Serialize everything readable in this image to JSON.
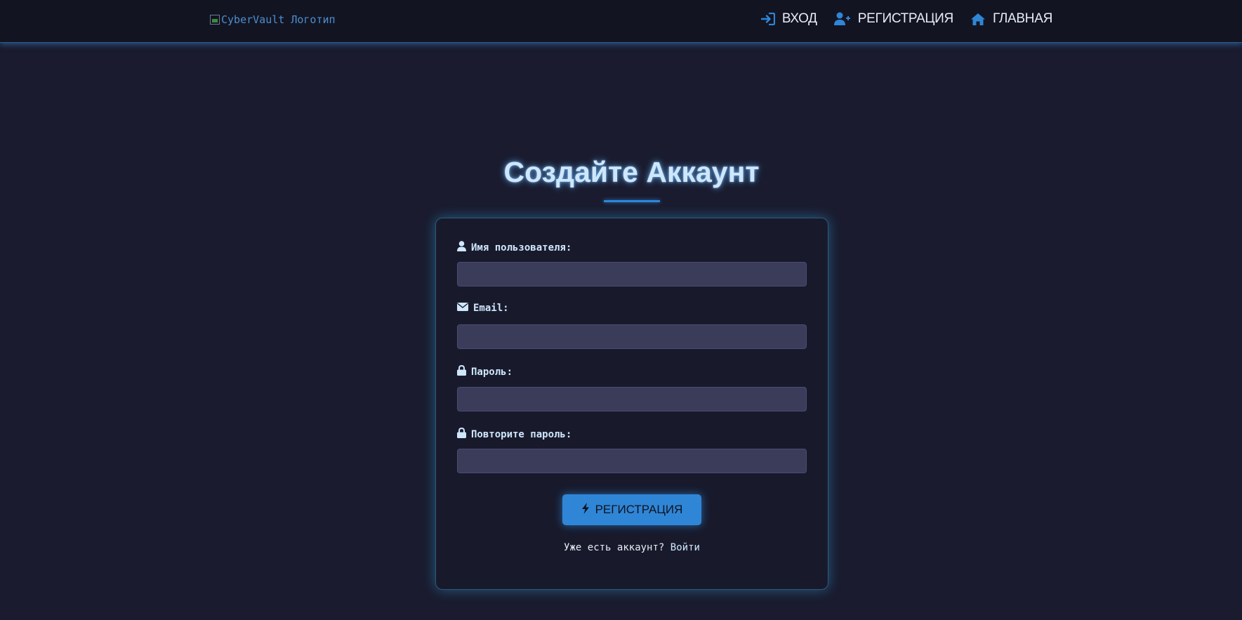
{
  "header": {
    "logo_alt": "CyberVault Логотип",
    "nav": [
      {
        "label": "ВХОД",
        "icon": "login-icon"
      },
      {
        "label": "РЕГИСТРАЦИЯ",
        "icon": "user-plus-icon"
      },
      {
        "label": "ГЛАВНАЯ",
        "icon": "home-icon"
      }
    ]
  },
  "main": {
    "title": "Создайте Аккаунт"
  },
  "form": {
    "fields": [
      {
        "label": "Имя пользователя:",
        "icon": "user-icon",
        "value": ""
      },
      {
        "label": "Email:",
        "icon": "envelope-icon",
        "value": ""
      },
      {
        "label": "Пароль:",
        "icon": "lock-icon",
        "value": ""
      },
      {
        "label": "Повторите пароль:",
        "icon": "lock-icon",
        "value": ""
      }
    ],
    "submit_label": "РЕГИСТРАЦИЯ",
    "submit_icon": "bolt-icon",
    "footer_text": "Уже есть аккаунт?",
    "footer_link": "Войти"
  },
  "colors": {
    "background": "#1a1b2e",
    "header": "#131422",
    "accent": "#2f86d6",
    "input": "#3b3b5a",
    "text": "#cfe6fb"
  }
}
